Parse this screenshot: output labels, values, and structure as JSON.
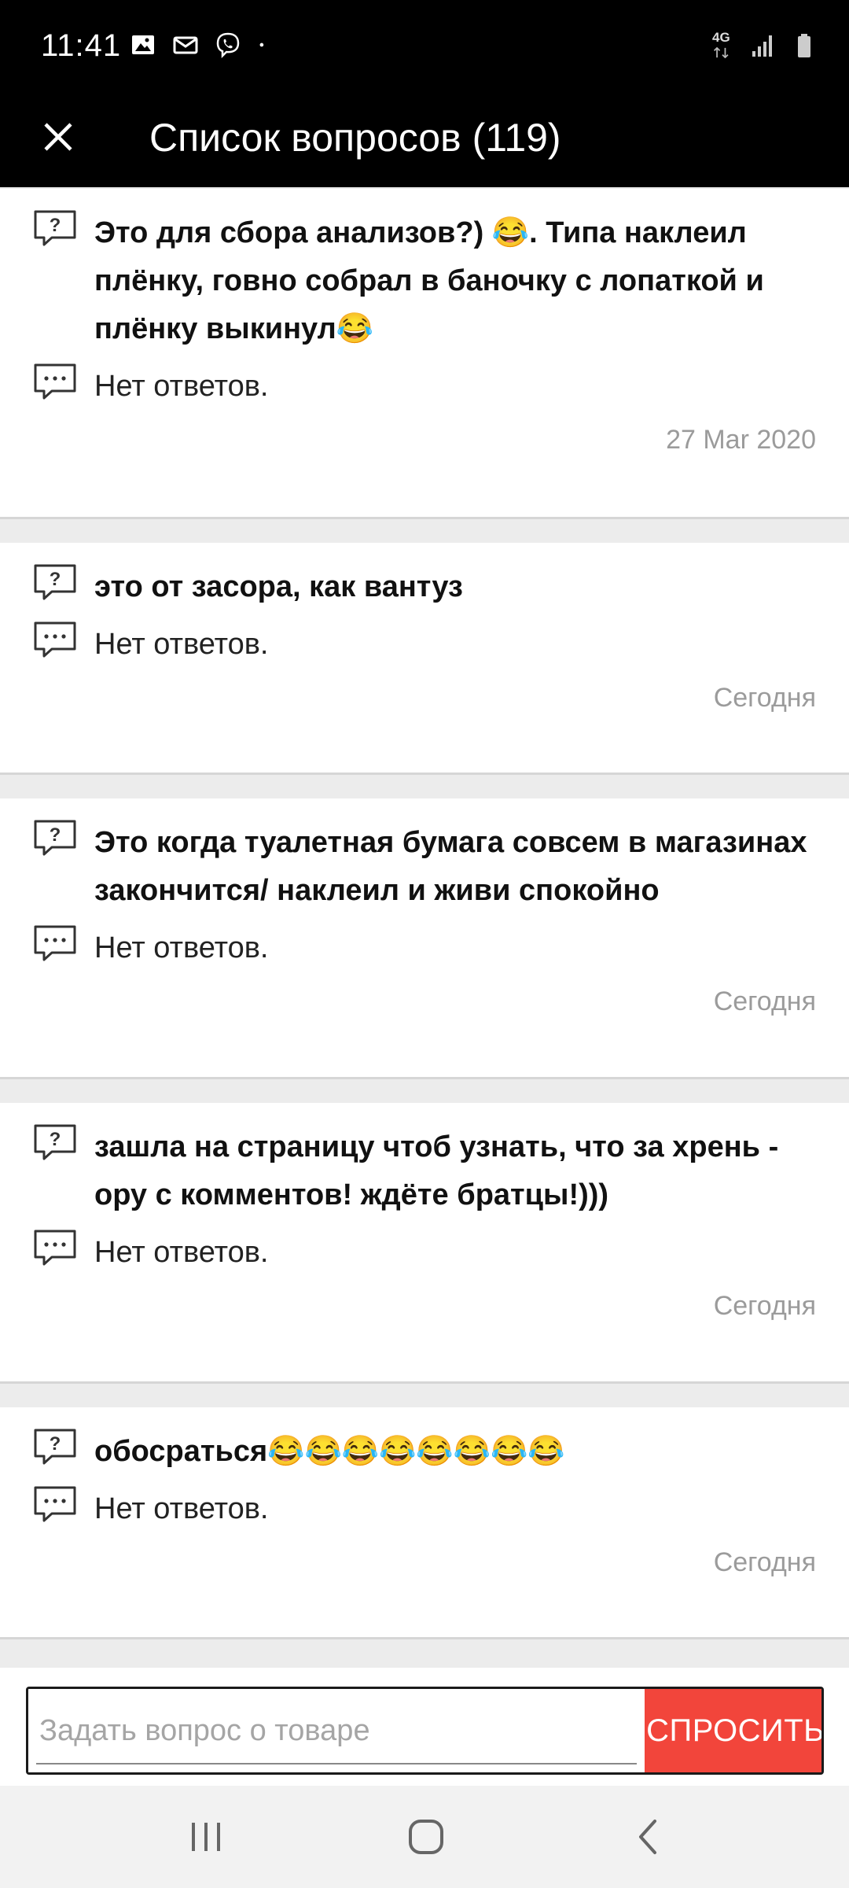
{
  "status_bar": {
    "time": "11:41",
    "network": "4G",
    "icons": [
      "image-icon",
      "mail-icon",
      "viber-icon",
      "dot-icon",
      "signal-icon",
      "battery-icon"
    ]
  },
  "header": {
    "title": "Список вопросов (119)",
    "close_icon": "close-icon"
  },
  "questions": [
    {
      "question": "Это для сбора анализов?) 😂. Типа наклеил плёнку, говно собрал в баночку с лопаткой и плёнку выкинул😂",
      "answer": "Нет ответов.",
      "date": "27 Mar 2020"
    },
    {
      "question": "это от засора,  как вантуз",
      "answer": "Нет ответов.",
      "date": "Сегодня"
    },
    {
      "question": "Это когда туалетная бумага совсем в магазинах закончится/ наклеил и живи спокойно",
      "answer": "Нет ответов.",
      "date": "Сегодня"
    },
    {
      "question": "зашла на страницу чтоб узнать, что за хрень - ору с комментов! ждёте братцы!)))",
      "answer": "Нет ответов.",
      "date": "Сегодня"
    },
    {
      "question": "обосраться😂😂😂😂😂😂😂😂",
      "answer": "Нет ответов.",
      "date": "Сегодня"
    }
  ],
  "ask_bar": {
    "placeholder": "Задать вопрос о товаре",
    "button_label": "СПРОСИТЬ",
    "button_color": "#f2453b"
  },
  "nav": {
    "recents_icon": "recents-icon",
    "home_icon": "home-icon",
    "back_icon": "back-icon"
  }
}
